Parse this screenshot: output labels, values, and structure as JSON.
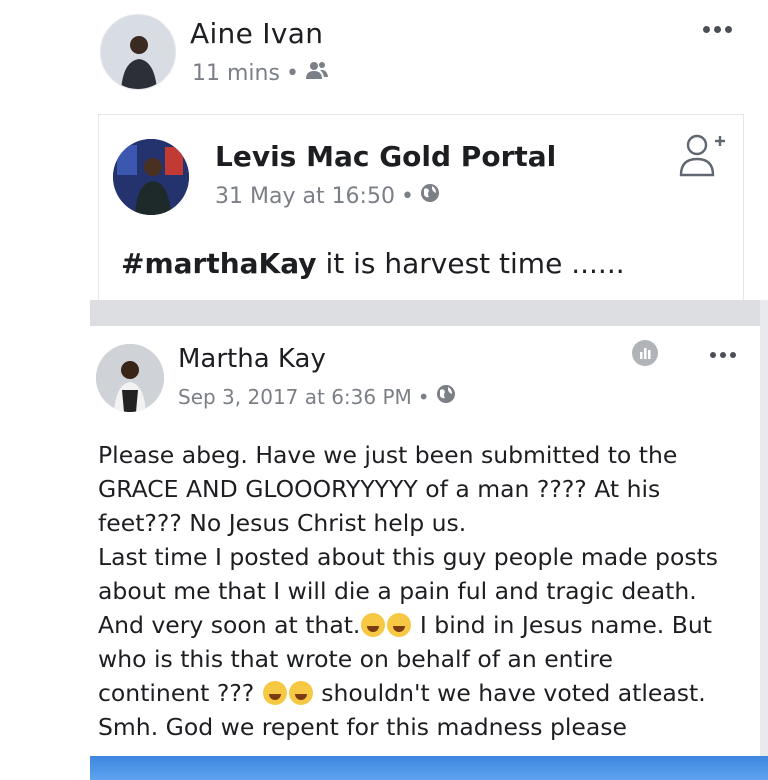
{
  "post": {
    "author": "Aine Ivan",
    "time": "11 mins",
    "audience_icon": "friends-icon",
    "shared": {
      "author": "Levis Mac Gold Portal",
      "time": "31 May at 16:50",
      "visibility_icon": "globe-icon",
      "text_hashtag": "#marthaKay",
      "text_rest": " it is harvest time ......"
    }
  },
  "quoted": {
    "author": "Martha Kay",
    "time": "Sep 3, 2017 at 6:36 PM",
    "visibility_icon": "globe-icon",
    "lines": [
      "Please abeg. Have we just been submitted to the",
      "GRACE AND GLOOORYYYYY of a man ???? At his",
      "feet??? No Jesus Christ help us.",
      "Last time I posted about this guy people made posts",
      "about me that I will die a pain ful and tragic death."
    ],
    "line6_a": "And very soon at that.",
    "line6_b": " I bind in Jesus name. But",
    "line7": "who is this that wrote on behalf of an entire",
    "line8_a": "continent ??? ",
    "line8_b": " shouldn't we have voted atleast.",
    "line9": "Smh. God we repent for this madness please"
  },
  "colors": {
    "meta_gray": "#7b7f86",
    "text": "#1c1e21",
    "separator": "#dcdee2",
    "accent_blue": "#3e87e0"
  }
}
